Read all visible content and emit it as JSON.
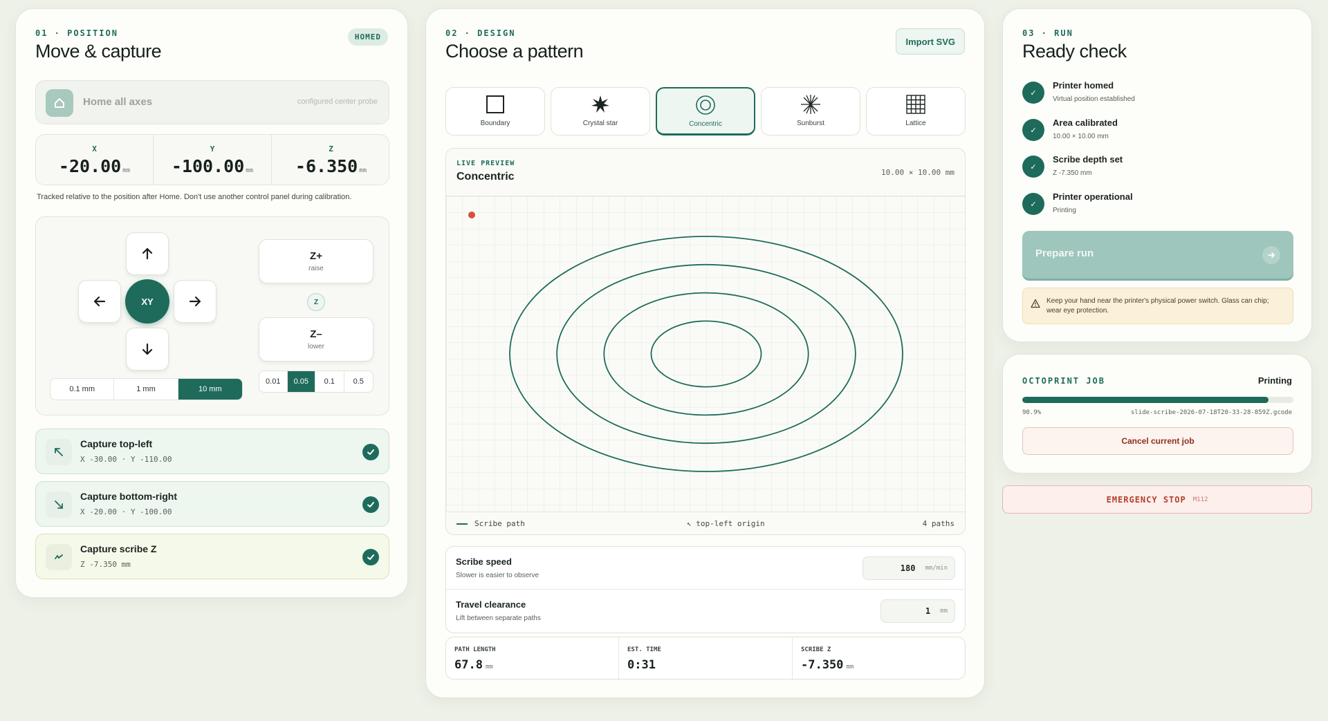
{
  "position": {
    "eyebrow": "01 · POSITION",
    "title": "Move & capture",
    "status_badge": "HOMED",
    "home_label": "Home all axes",
    "home_hint": "configured center probe",
    "coords": [
      {
        "axis": "X",
        "value": "-20.00",
        "unit": "mm"
      },
      {
        "axis": "Y",
        "value": "-100.00",
        "unit": "mm"
      },
      {
        "axis": "Z",
        "value": "-6.350",
        "unit": "mm"
      }
    ],
    "note": "Tracked relative to the position after Home. Don't use another control panel during calibration.",
    "xy_label": "XY",
    "z_up": {
      "label": "Z+",
      "sub": "raise"
    },
    "z_down": {
      "label": "Z–",
      "sub": "lower"
    },
    "z_center": "Z",
    "xy_steps": [
      "0.1 mm",
      "1 mm",
      "10 mm"
    ],
    "xy_step_selected": "10 mm",
    "z_steps": [
      "0.01",
      "0.05",
      "0.1",
      "0.5"
    ],
    "z_step_selected": "0.05",
    "captures": [
      {
        "title": "Capture top-left",
        "detail": "X -30.00 · Y -110.00",
        "icon": "arrow-up-left-icon",
        "done": true
      },
      {
        "title": "Capture bottom-right",
        "detail": "X -20.00 · Y -100.00",
        "icon": "arrow-down-right-icon",
        "done": true
      },
      {
        "title": "Capture scribe Z",
        "detail": "Z -7.350 mm",
        "icon": "scribe-icon",
        "done": true
      }
    ]
  },
  "design": {
    "eyebrow": "02 · DESIGN",
    "title": "Choose a pattern",
    "import_label": "Import SVG",
    "patterns": [
      {
        "label": "Boundary",
        "icon": "square-icon"
      },
      {
        "label": "Crystal star",
        "icon": "star-icon"
      },
      {
        "label": "Concentric",
        "icon": "concentric-icon"
      },
      {
        "label": "Sunburst",
        "icon": "sunburst-icon"
      },
      {
        "label": "Lattice",
        "icon": "lattice-icon"
      }
    ],
    "selected_pattern": "Concentric",
    "preview": {
      "eyebrow": "LIVE PREVIEW",
      "name": "Concentric",
      "size": "10.00 × 10.00 mm",
      "legend": "Scribe path",
      "origin": "↖ top-left origin",
      "paths": "4 paths",
      "ring_fractions": [
        1.0,
        0.76,
        0.52,
        0.28
      ],
      "stroke_color": "#1f6b5b",
      "head_color": "#d9503c"
    },
    "settings": [
      {
        "title": "Scribe speed",
        "sub": "Slower is easier to observe",
        "value": "180",
        "unit": "mm/min"
      },
      {
        "title": "Travel clearance",
        "sub": "Lift between separate paths",
        "value": "1",
        "unit": "mm"
      }
    ],
    "stats": [
      {
        "label": "PATH LENGTH",
        "value": "67.8",
        "unit": "mm"
      },
      {
        "label": "EST. TIME",
        "value": "0:31",
        "unit": ""
      },
      {
        "label": "SCRIBE Z",
        "value": "-7.350",
        "unit": "mm"
      }
    ]
  },
  "run": {
    "eyebrow": "03 · RUN",
    "title": "Ready check",
    "checks": [
      {
        "title": "Printer homed",
        "sub": "Virtual position established"
      },
      {
        "title": "Area calibrated",
        "sub": "10.00 × 10.00 mm"
      },
      {
        "title": "Scribe depth set",
        "sub": "Z -7.350 mm"
      },
      {
        "title": "Printer operational",
        "sub": "Printing"
      }
    ],
    "check_mark": "✓",
    "prepare_label": "Prepare run",
    "warning": "Keep your hand near the printer's physical power switch. Glass can chip; wear eye protection."
  },
  "job": {
    "title": "OCTOPRINT JOB",
    "state": "Printing",
    "progress_label": "90.9%",
    "progress": 0.909,
    "filename": "slide-scribe-2026-07-18T20-33-28-859Z.gcode",
    "cancel_label": "Cancel current job"
  },
  "estop": {
    "label": "EMERGENCY STOP",
    "code": "M112"
  },
  "colors": {
    "accent": "#1f6b5b",
    "danger": "#b1402e",
    "warning_bg": "#fbf0d9"
  }
}
